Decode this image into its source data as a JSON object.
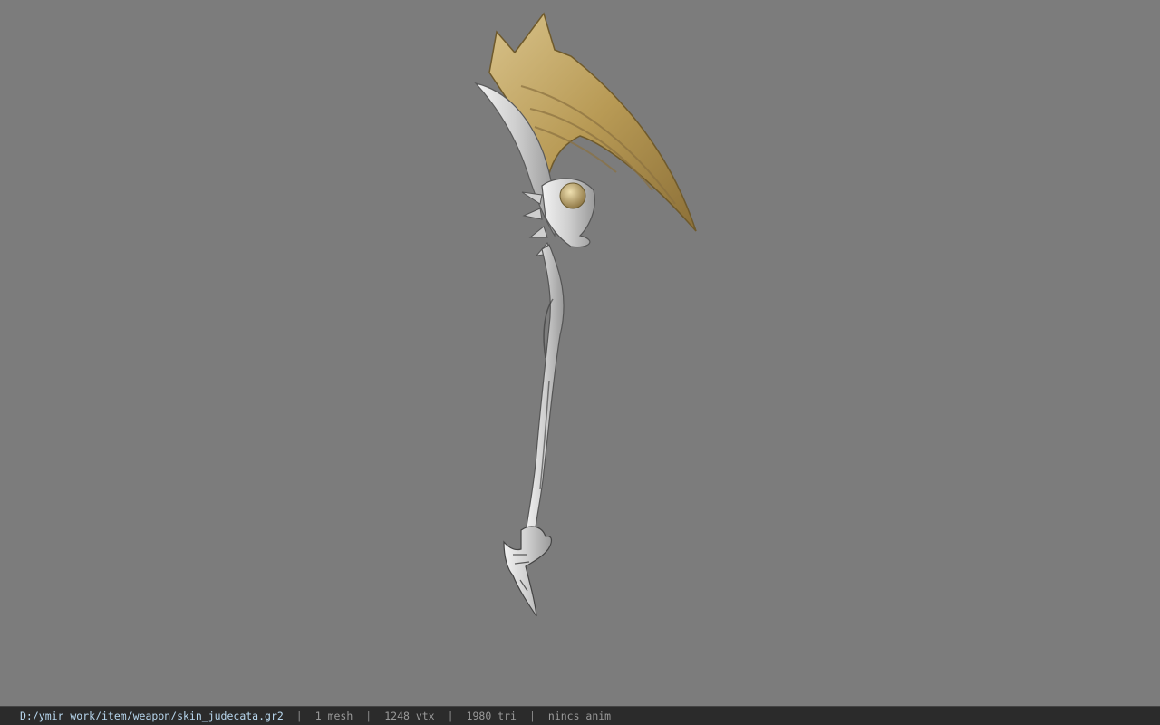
{
  "viewer": {
    "background_color": "#7c7c7c",
    "model_icon": "scythe-model"
  },
  "status_bar": {
    "file_path": "D:/ymir work/item/weapon/skin_judecata.gr2",
    "separator": "|",
    "mesh": "1 mesh",
    "vertices": "1248 vtx",
    "triangles": "1980 tri",
    "animation": "nincs anim",
    "path_color": "#b8d7ee"
  }
}
